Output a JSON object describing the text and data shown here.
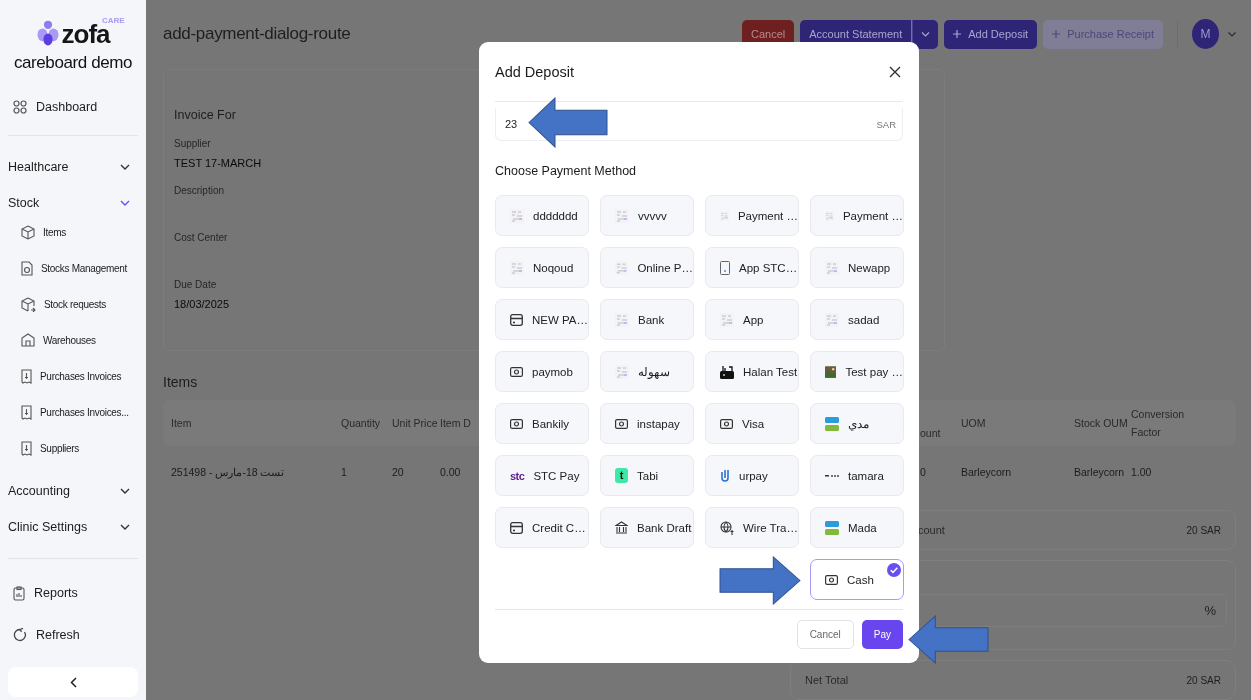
{
  "sidebar": {
    "logo": "zofa",
    "logo_tag": "CARE",
    "org": "careboard demo",
    "top_items": [
      {
        "label": "Dashboard"
      }
    ],
    "groups": [
      {
        "label": "Healthcare",
        "expanded": false
      },
      {
        "label": "Stock",
        "expanded": true,
        "children": [
          {
            "label": "Items"
          },
          {
            "label": "Stocks Management"
          },
          {
            "label": "Stock requests"
          },
          {
            "label": "Warehouses"
          },
          {
            "label": "Purchases Invoices"
          },
          {
            "label": "Purchases Invoices..."
          },
          {
            "label": "Suppliers"
          }
        ]
      },
      {
        "label": "Accounting",
        "expanded": false
      },
      {
        "label": "Clinic Settings",
        "expanded": false
      }
    ],
    "bottom_items": [
      {
        "label": "Reports"
      },
      {
        "label": "Refresh"
      }
    ]
  },
  "header": {
    "title": "add-payment-dialog-route",
    "buttons": [
      {
        "kind": "danger",
        "label": "Cancel"
      },
      {
        "kind": "split",
        "label": "Account Statement"
      },
      {
        "kind": "add",
        "label": "Add Deposit"
      },
      {
        "kind": "add-muted",
        "label": "Purchase Receipt"
      }
    ],
    "avatar": "M"
  },
  "invoice": {
    "heading": "Invoice For",
    "fields": [
      {
        "label": "Supplier",
        "value": "TEST 17-MARCH"
      },
      {
        "label": "Description"
      },
      {
        "label": "Cost Center"
      },
      {
        "label": "Due Date",
        "value": "18/03/2025"
      }
    ]
  },
  "items": {
    "heading": "Items",
    "columns": [
      "Item",
      "Quantity",
      "Unit Price",
      "Item D",
      "ount",
      "UOM",
      "Stock OUM",
      "Conversion Factor"
    ],
    "rows": [
      [
        "251498 - تست 18-مارس",
        "1",
        "20",
        "0.00",
        "0",
        "Barleycorn",
        "Barleycorn",
        "1.00"
      ]
    ]
  },
  "summary": [
    {
      "kind": "total",
      "label": "count",
      "value": "20 SAR"
    },
    {
      "kind": "percent-field",
      "suffix": "%"
    },
    {
      "kind": "total",
      "label": "Net Total",
      "value": "20 SAR"
    }
  ],
  "dialog": {
    "title": "Add Deposit",
    "amount": {
      "value": "23",
      "currency": "SAR"
    },
    "section": "Choose Payment Method",
    "methods": [
      {
        "kind": "thumb",
        "label": "ddddddd",
        "selected": false
      },
      {
        "kind": "thumb",
        "label": "vvvvv",
        "selected": false
      },
      {
        "kind": "thumb",
        "label": "Payment …",
        "selected": false
      },
      {
        "kind": "thumb",
        "label": "Payment …",
        "selected": false
      },
      {
        "kind": "thumb",
        "label": "Noqoud",
        "selected": false
      },
      {
        "kind": "thumb",
        "label": "Online P…",
        "selected": false
      },
      {
        "kind": "phone",
        "label": "App STC…",
        "selected": false
      },
      {
        "kind": "thumb",
        "label": "Newapp",
        "selected": false
      },
      {
        "kind": "card",
        "label": "NEW PA…",
        "selected": false
      },
      {
        "kind": "thumb",
        "label": "Bank",
        "selected": false
      },
      {
        "kind": "thumb",
        "label": "App",
        "selected": false
      },
      {
        "kind": "thumb",
        "label": "sadad",
        "selected": false
      },
      {
        "kind": "cash",
        "label": "paymob",
        "selected": false
      },
      {
        "kind": "thumb",
        "label": "سهوله",
        "selected": false
      },
      {
        "kind": "halan",
        "label": "Halan Test",
        "selected": false
      },
      {
        "kind": "photo",
        "label": "Test pay …",
        "selected": false
      },
      {
        "kind": "cash",
        "label": "Bankily",
        "selected": false
      },
      {
        "kind": "cash",
        "label": "instapay",
        "selected": false
      },
      {
        "kind": "cash",
        "label": "Visa",
        "selected": false
      },
      {
        "kind": "mada",
        "label": "مدي",
        "selected": false
      },
      {
        "kind": "text-logo",
        "logo": "stc",
        "label": "STC Pay",
        "selected": false
      },
      {
        "kind": "tabi",
        "logo": "t",
        "label": "Tabi",
        "selected": false
      },
      {
        "kind": "urpay",
        "label": "urpay",
        "selected": false
      },
      {
        "kind": "dots",
        "label": "tamara",
        "selected": false
      },
      {
        "kind": "card",
        "label": "Credit C…",
        "selected": false
      },
      {
        "kind": "bank",
        "label": "Bank Draft",
        "selected": false
      },
      {
        "kind": "globe",
        "label": "Wire Tra…",
        "selected": false
      },
      {
        "kind": "mada",
        "label": "Mada",
        "selected": false
      },
      {
        "kind": "cash",
        "label": "Cash",
        "selected": true
      }
    ],
    "buttons": {
      "cancel": "Cancel",
      "pay": "Pay"
    }
  },
  "annotations": [
    {
      "kind": "left"
    },
    {
      "kind": "right"
    },
    {
      "kind": "left"
    }
  ]
}
